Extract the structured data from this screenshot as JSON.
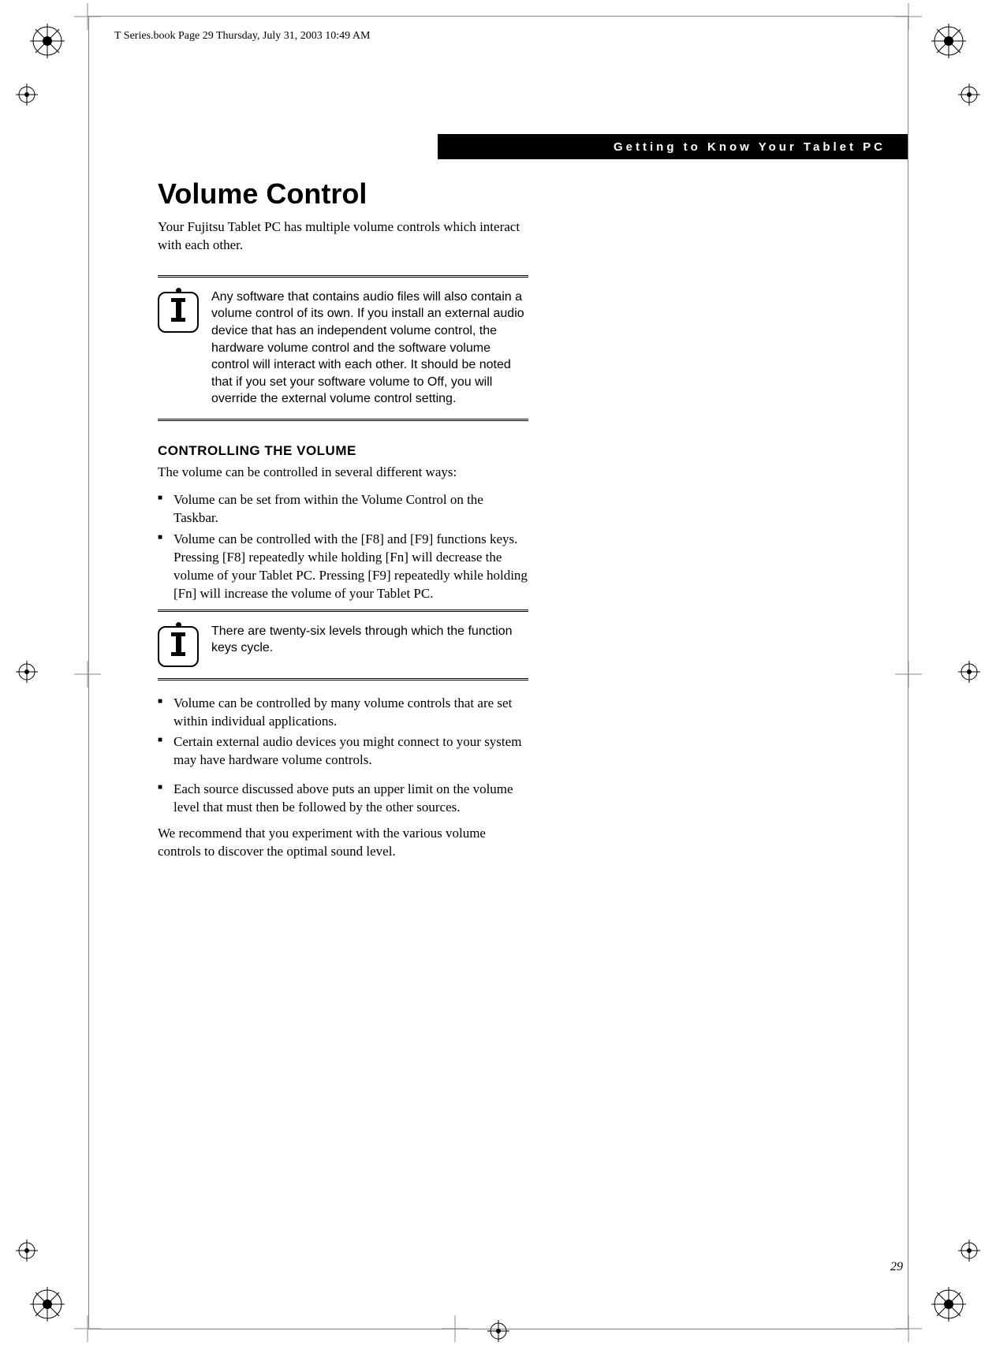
{
  "header_line": "T Series.book  Page 29  Thursday, July 31, 2003  10:49 AM",
  "section_tab": "Getting to Know Your Tablet PC",
  "title": "Volume Control",
  "intro": "Your Fujitsu Tablet PC has multiple volume controls which interact with each other.",
  "info1": "Any software that contains audio files will also contain a volume control of its own. If you install an external audio device that has an independent volume control, the hardware volume control and the software volume control will interact with each other. It should be noted that if you set your software volume to Off, you will override the external volume control setting.",
  "subhead": "CONTROLLING THE VOLUME",
  "lead": "The volume can be controlled in several different ways:",
  "bullets_a": [
    "Volume can be set from within the Volume Control on the Taskbar.",
    "Volume can be controlled with the [F8] and [F9] functions keys. Pressing [F8] repeatedly while holding [Fn] will decrease the volume of your Tablet PC. Pressing [F9] repeatedly while holding [Fn] will increase the volume of your Tablet PC."
  ],
  "info2": "There are twenty-six levels through which the function keys cycle.",
  "bullets_b": [
    "Volume can be controlled by many volume controls that are set within individual applications.",
    "Certain external audio devices you might connect to your system may have hardware volume controls."
  ],
  "bullets_c": [
    "Each source discussed above puts an upper limit on the volume level that must then be followed by the other sources."
  ],
  "closing": "We recommend that you experiment with the various volume controls to discover the optimal sound level.",
  "page_number": "29"
}
